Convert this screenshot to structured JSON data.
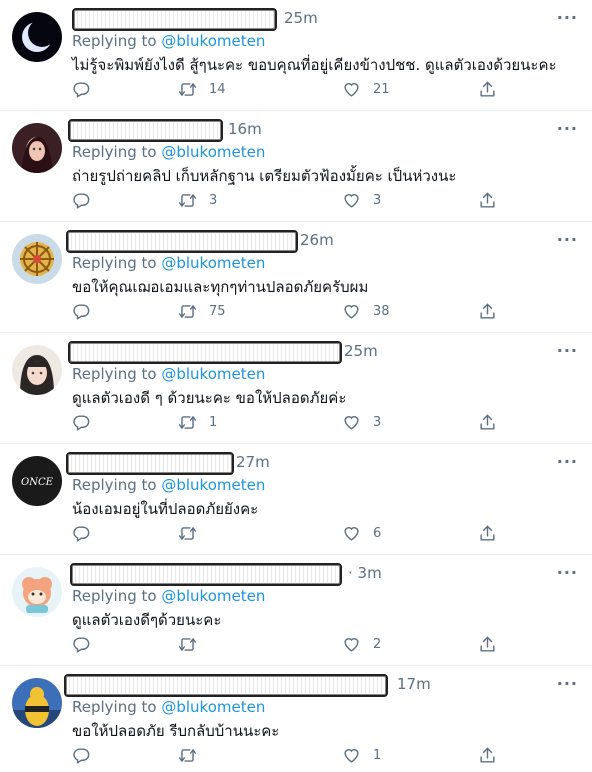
{
  "replying_prefix": "Replying to",
  "tweets": [
    {
      "time": "25m",
      "handle": "@blukometen",
      "text": "ไม่รู้จะพิมพ์ยังไงดี สู้ๆนะคะ ขอบคุณที่อยู่เคียงข้างปชช. ดูแลตัวเองด้วยนะคะ",
      "reply_count": "",
      "retweet_count": "14",
      "like_count": "21"
    },
    {
      "time": "16m",
      "handle": "@blukometen",
      "text": "ถ่ายรูปถ่ายคลิป เก็บหลักฐาน เตรียมตัวฟ้องมั้ยคะ เป็นห่วงนะ",
      "reply_count": "",
      "retweet_count": "3",
      "like_count": "3"
    },
    {
      "time": "26m",
      "handle": "@blukometen",
      "text": "ขอให้คุณเฌอเอมและทุกๆท่านปลอดภัยครับผม",
      "reply_count": "",
      "retweet_count": "75",
      "like_count": "38"
    },
    {
      "time": "25m",
      "handle": "@blukometen",
      "text": "ดูแลตัวเองดี ๆ ด้วยนะคะ ขอให้ปลอดภัยค่ะ",
      "reply_count": "",
      "retweet_count": "1",
      "like_count": "3"
    },
    {
      "time": "27m",
      "handle": "@blukometen",
      "text": "น้องเอมอยู่ในที่ปลอดภัยยังคะ",
      "reply_count": "",
      "retweet_count": "",
      "like_count": "6",
      "avatar_text": "ONCE"
    },
    {
      "time": "· 3m",
      "handle": "@blukometen",
      "text": "ดูแลตัวเองดีๆด้วยนะคะ",
      "reply_count": "",
      "retweet_count": "",
      "like_count": "2"
    },
    {
      "time": "17m",
      "handle": "@blukometen",
      "text": "ขอให้ปลอดภัย รีบกลับบ้านนะคะ",
      "reply_count": "",
      "retweet_count": "",
      "like_count": "1"
    }
  ],
  "icons": {
    "reply": "reply-icon",
    "retweet": "retweet-icon",
    "like": "like-icon",
    "share": "share-icon",
    "more": "more-icon"
  },
  "colors": {
    "secondary_text": "#5b7083",
    "link": "#1b95e0",
    "divider": "#e6ecf0"
  }
}
